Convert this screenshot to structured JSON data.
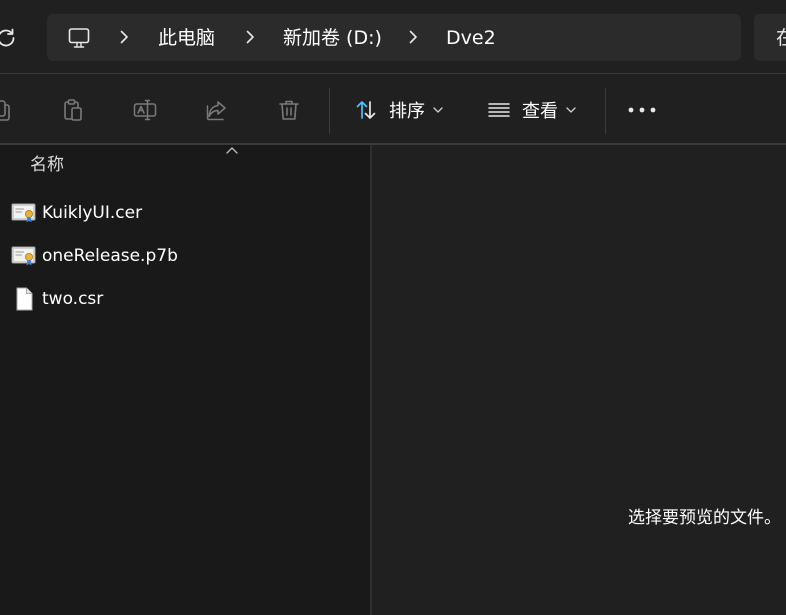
{
  "breadcrumb": {
    "items": [
      "此电脑",
      "新加卷 (D:)",
      "Dve2"
    ]
  },
  "search": {
    "text": "在"
  },
  "toolbar": {
    "sort_label": "排序",
    "view_label": "查看"
  },
  "list": {
    "column_header": "名称",
    "files": [
      {
        "name": "KuiklyUI.cer",
        "icon": "certificate-icon"
      },
      {
        "name": "oneRelease.p7b",
        "icon": "certificate-icon"
      },
      {
        "name": "two.csr",
        "icon": "document-icon"
      }
    ]
  },
  "preview": {
    "message": "选择要预览的文件。"
  },
  "colors": {
    "accent": "#4cc2ff",
    "background": "#191919",
    "bar": "#202020",
    "field": "#2b2b2b"
  }
}
